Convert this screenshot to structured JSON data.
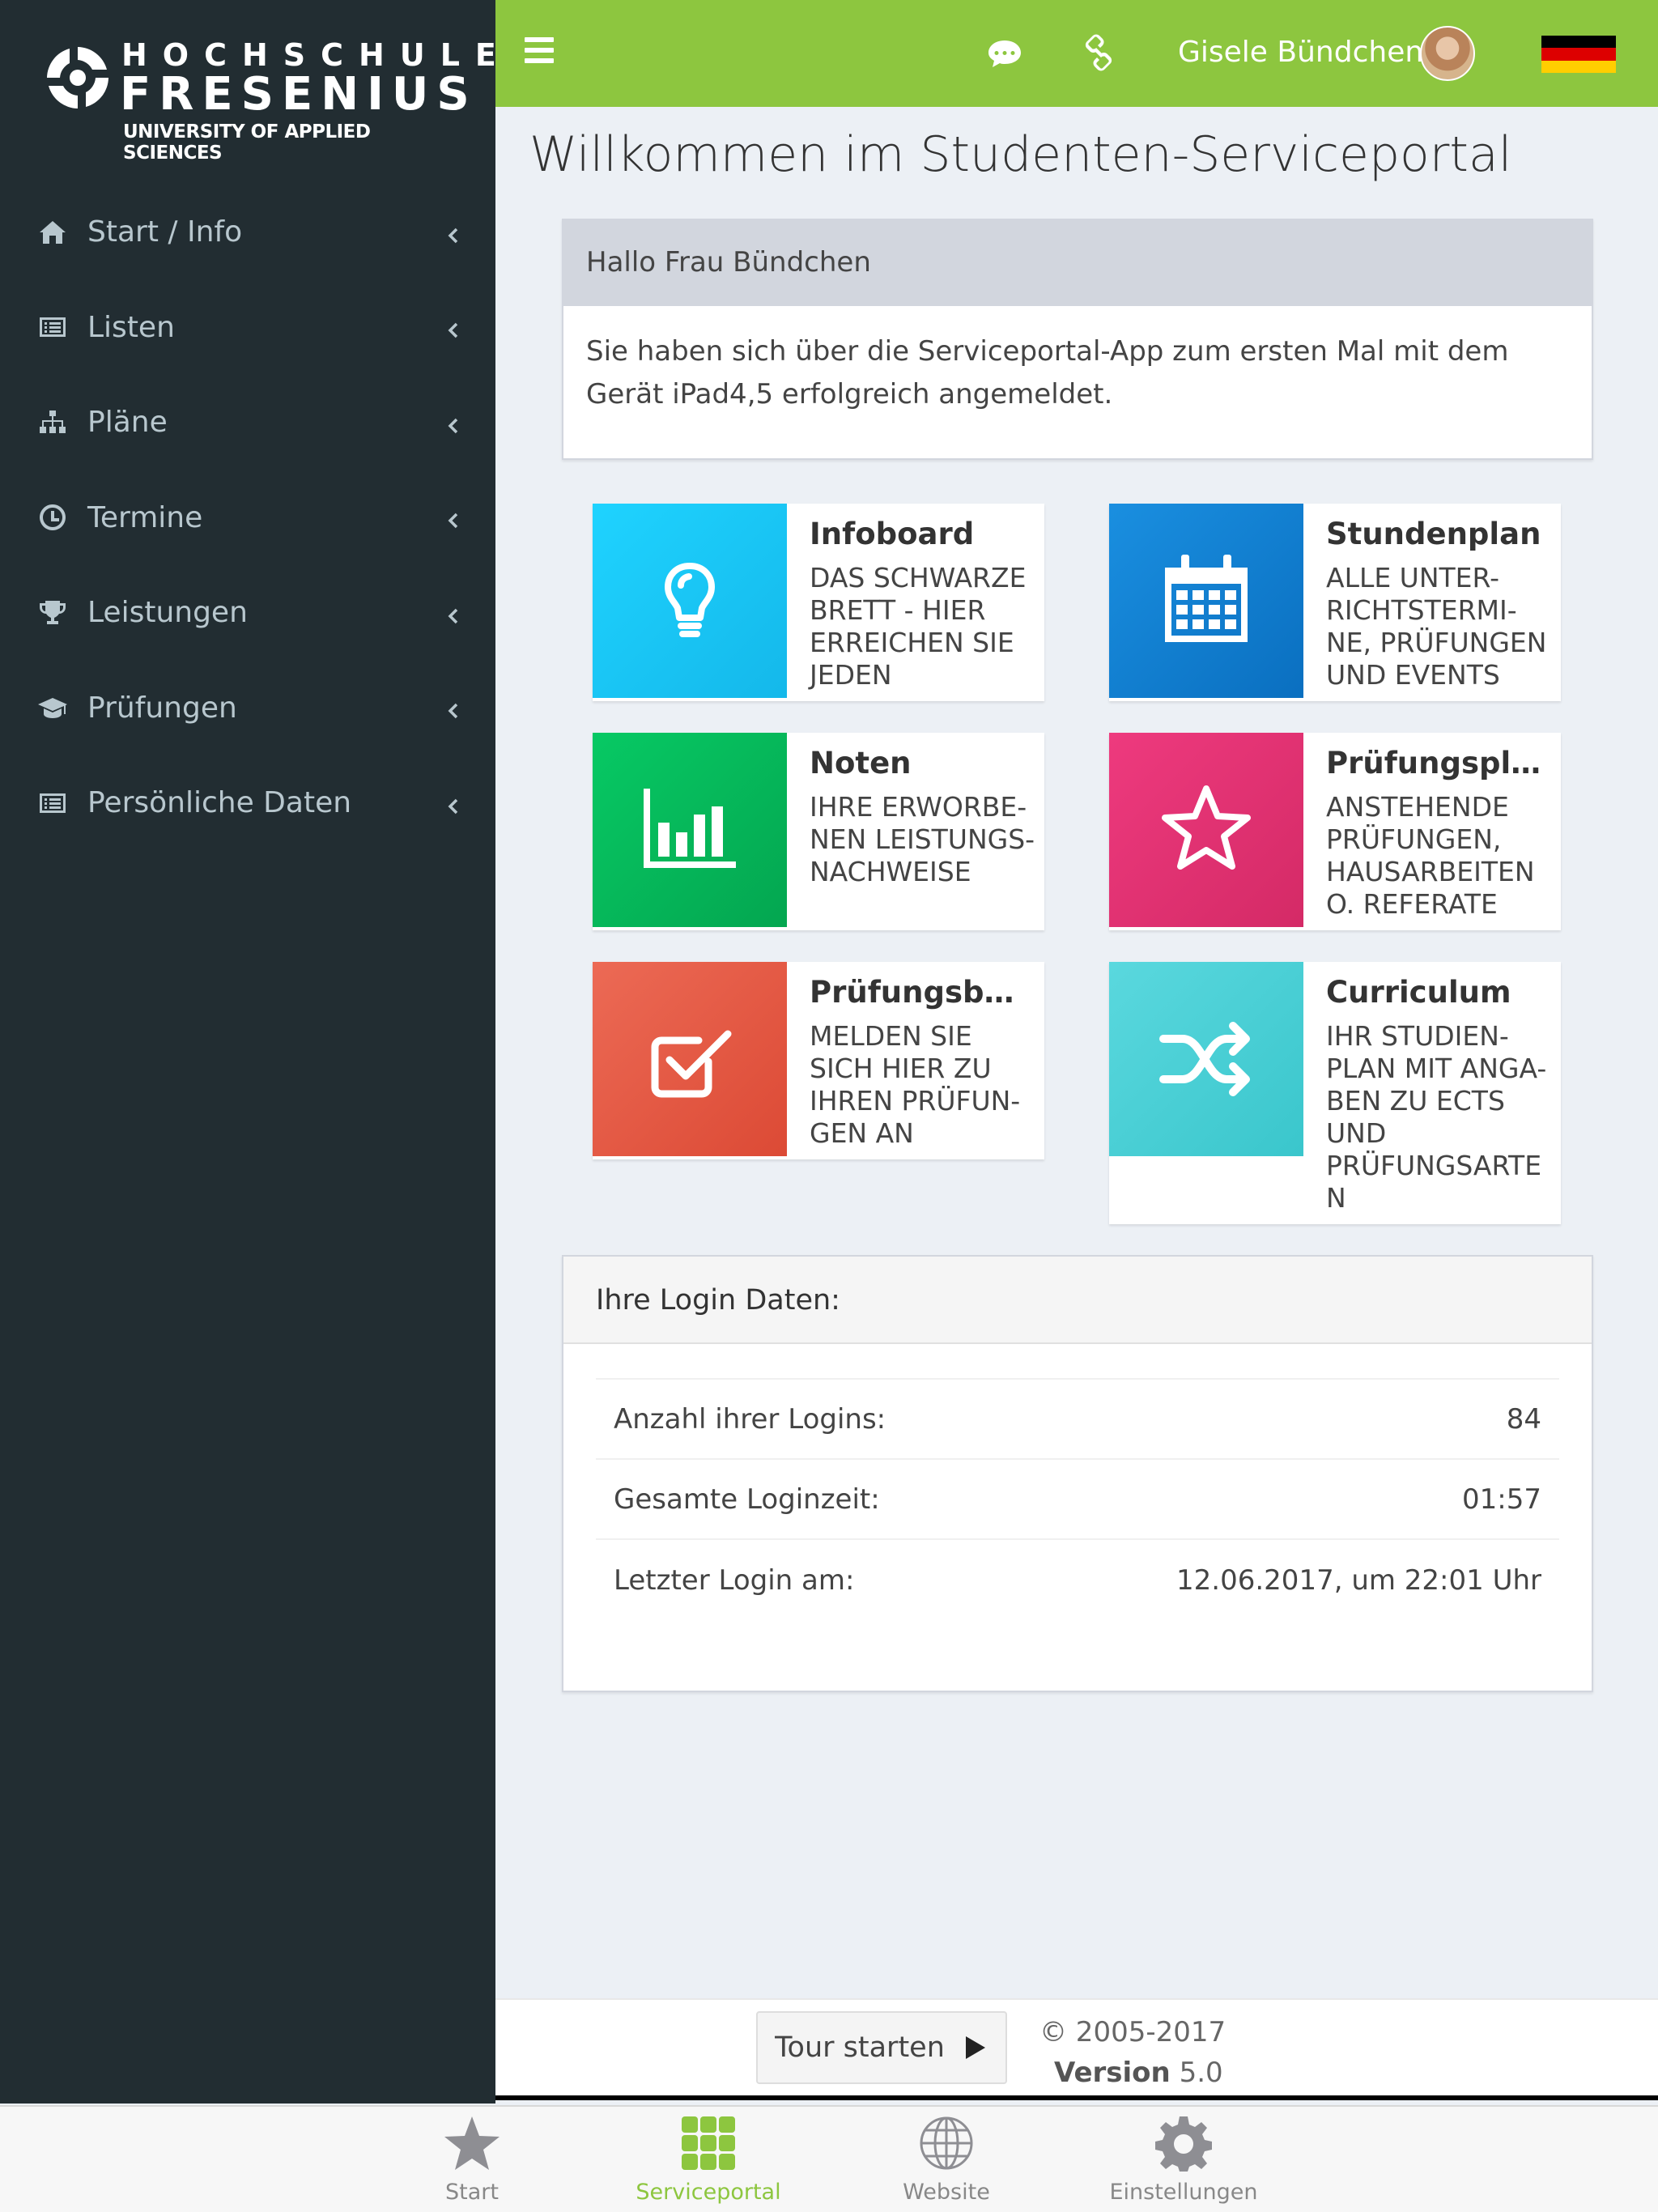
{
  "brand": {
    "line1": "HOCHSCHULE",
    "line2": "FRESENIUS",
    "line3": "UNIVERSITY OF APPLIED SCIENCES"
  },
  "sidebar": {
    "items": [
      {
        "label": "Start / Info",
        "icon": "home-icon"
      },
      {
        "label": "Listen",
        "icon": "list-icon"
      },
      {
        "label": "Pläne",
        "icon": "sitemap-icon"
      },
      {
        "label": "Termine",
        "icon": "clock-icon"
      },
      {
        "label": "Leistungen",
        "icon": "trophy-icon"
      },
      {
        "label": "Prüfungen",
        "icon": "graduation-cap-icon"
      },
      {
        "label": "Persönliche Daten",
        "icon": "list-icon"
      }
    ]
  },
  "header": {
    "user_name": "Gisele Bündchen",
    "language": "de",
    "accent": "#8dc63f"
  },
  "page": {
    "title": "Willkommen im Studenten-Serviceportal"
  },
  "welcome": {
    "greeting": "Hallo Frau Bündchen",
    "message": "Sie haben sich über die Serviceportal-App zum ersten Mal mit dem Gerät iPad4,5 erfolgreich angemeldet."
  },
  "tiles": [
    {
      "title": "Infoboard",
      "desc": "DAS SCHWARZE BRETT - HIER ERREICHEN SIE JEDEN",
      "color": "#1ac6f0",
      "icon": "lightbulb-icon"
    },
    {
      "title": "Stundenplan",
      "desc": "ALLE UNTER-RICHTSTERMI-NE, PRÜFUNGEN UND EVENTS",
      "color": "#0a7fd0",
      "icon": "calendar-icon"
    },
    {
      "title": "Noten",
      "desc": "IHRE ERWORBE-NEN LEISTUNGS-NACHWEISE",
      "color": "#06b45a",
      "icon": "bar-chart-icon"
    },
    {
      "title": "Prüfungsplan",
      "desc": "ANSTEHENDE PRÜFUNGEN, HAUSARBEITEN O. REFERATE",
      "color": "#e23070",
      "icon": "star-icon"
    },
    {
      "title": "Prüfungsbel...",
      "desc": "MELDEN SIE SICH HIER ZU IHREN PRÜFUN-GEN AN",
      "color": "#e5573f",
      "icon": "checkbox-icon"
    },
    {
      "title": "Curriculum",
      "desc": "IHR STUDIEN-PLAN MIT ANGA-BEN ZU ECTS UND PRÜFUNGSARTE N",
      "color": "#46ced6",
      "icon": "shuffle-icon"
    }
  ],
  "login": {
    "title": "Ihre Login Daten:",
    "rows": [
      {
        "label": "Anzahl ihrer Logins:",
        "value": "84"
      },
      {
        "label": "Gesamte Loginzeit:",
        "value": "01:57"
      },
      {
        "label": "Letzter Login am:",
        "value": "12.06.2017, um 22:01 Uhr"
      }
    ]
  },
  "footer": {
    "tour_label": "Tour starten",
    "copyright": "© 2005-2017",
    "version_label": "Version",
    "version_value": "5.0"
  },
  "tabbar": {
    "items": [
      {
        "label": "Start",
        "icon": "star-icon"
      },
      {
        "label": "Serviceportal",
        "icon": "grid-icon",
        "active": true
      },
      {
        "label": "Website",
        "icon": "globe-icon"
      },
      {
        "label": "Einstellungen",
        "icon": "gear-icon"
      }
    ]
  }
}
